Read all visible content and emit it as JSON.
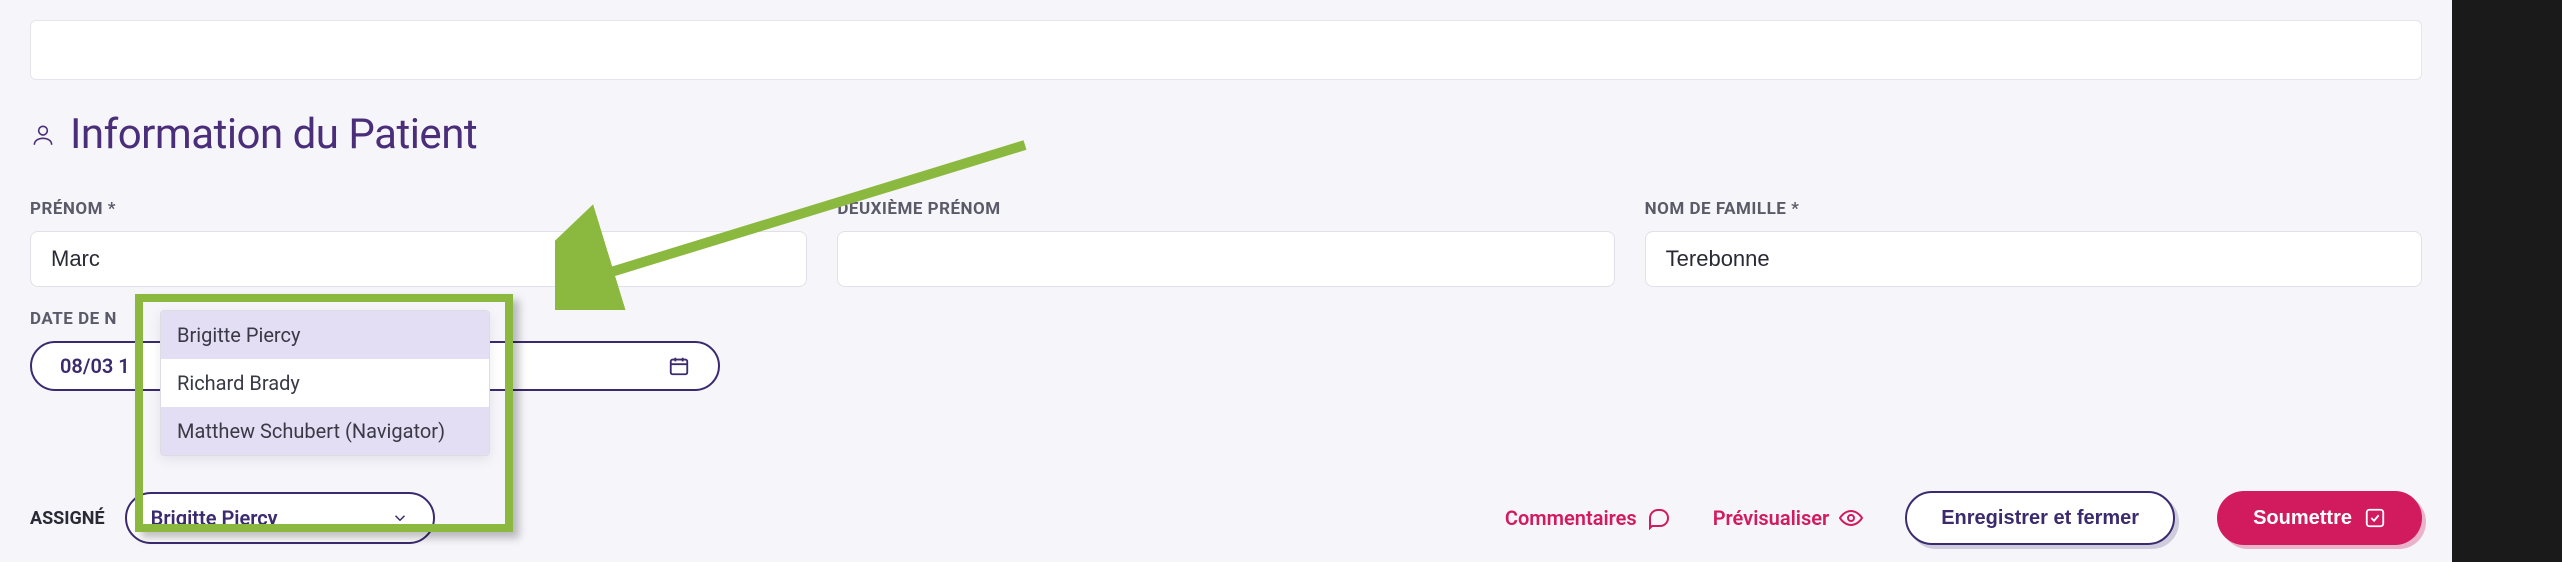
{
  "section": {
    "title": "Information du Patient"
  },
  "fields": {
    "prenom_label": "PRÉNOM *",
    "prenom_value": "Marc",
    "deuxieme_label": "DEUXIÈME PRÉNOM",
    "deuxieme_value": "",
    "nom_label": "NOM DE FAMILLE *",
    "nom_value": "Terebonne",
    "date_label": "DATE DE N",
    "date_value": "08/03 1"
  },
  "assignee": {
    "label": "ASSIGNÉ",
    "selected": "Brigitte Piercy",
    "options": [
      {
        "label": "Brigitte Piercy",
        "highlighted": true
      },
      {
        "label": "Richard Brady",
        "highlighted": false
      },
      {
        "label": "Matthew Schubert (Navigator)",
        "highlighted": true
      }
    ]
  },
  "actions": {
    "commentaires": "Commentaires",
    "previsualiser": "Prévisualiser",
    "enregistrer": "Enregistrer et fermer",
    "soumettre": "Soumettre"
  },
  "colors": {
    "accent_purple": "#4a2e7a",
    "accent_pink": "#d11b5e",
    "highlight_green": "#8bb93f"
  }
}
